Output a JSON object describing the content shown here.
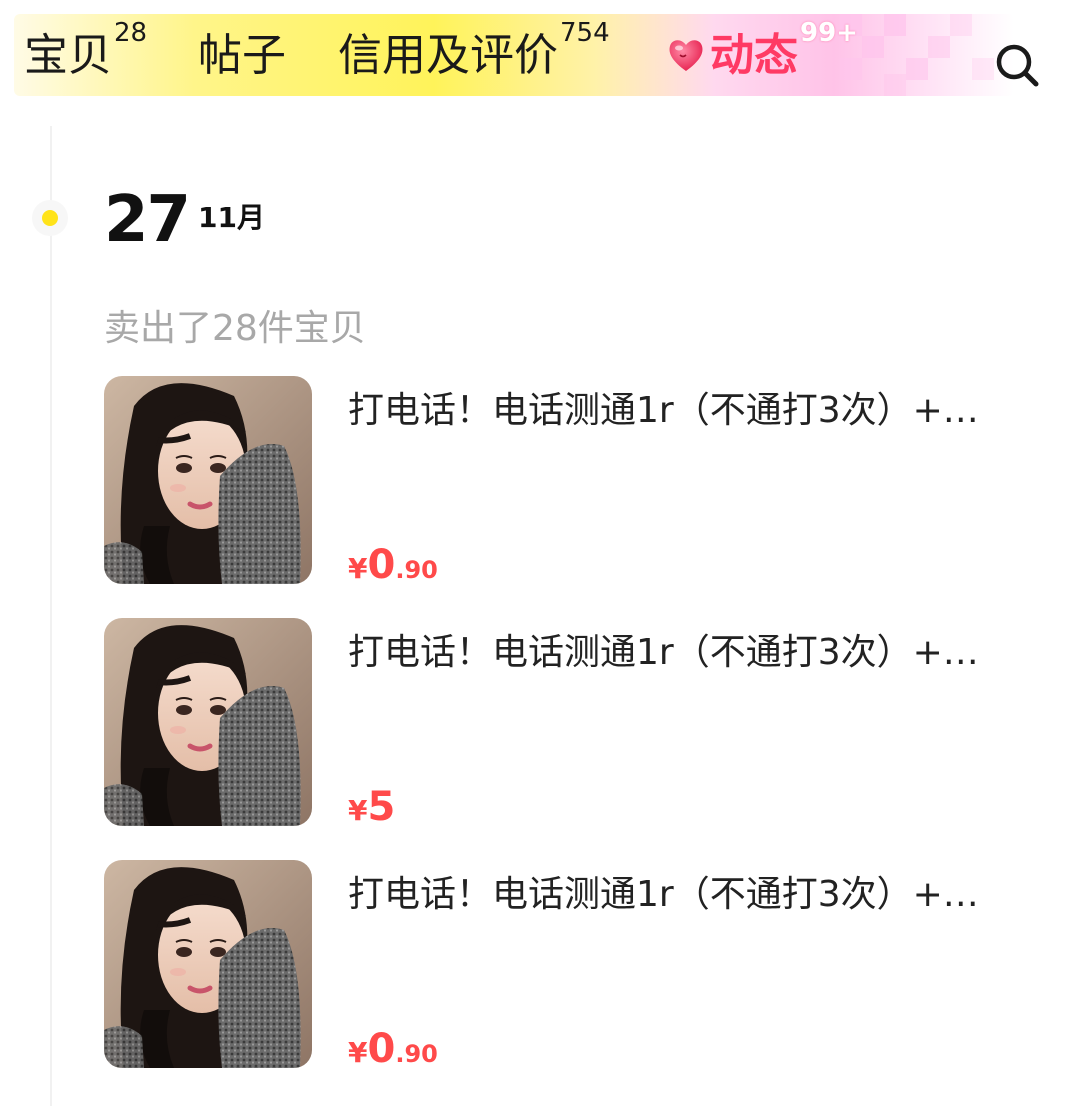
{
  "tabs": [
    {
      "label": "宝贝",
      "badge": "28"
    },
    {
      "label": "帖子",
      "badge": ""
    },
    {
      "label": "信用及评价",
      "badge": "754"
    },
    {
      "label": "动态",
      "badge": "99+",
      "active": true,
      "icon": "heart-icon"
    }
  ],
  "search": {
    "icon": "search-icon"
  },
  "timeline": {
    "date_day": "27",
    "date_month": "11月",
    "summary": "卖出了28件宝贝"
  },
  "items": [
    {
      "title": "打电话！电话测通1r（不通打3次）+…",
      "price": {
        "currency": "¥",
        "integer": "0",
        "decimal": ".90"
      }
    },
    {
      "title": "打电话！电话测通1r（不通打3次）+…",
      "price": {
        "currency": "¥",
        "integer": "5",
        "decimal": ""
      }
    },
    {
      "title": "打电话！电话测通1r（不通打3次）+…",
      "price": {
        "currency": "¥",
        "integer": "0",
        "decimal": ".90"
      }
    }
  ],
  "colors": {
    "accent_yellow": "#ffe31a",
    "active_tab": "#ff3a64",
    "price": "#ff4a4a",
    "muted_text": "#a8a8a8"
  }
}
